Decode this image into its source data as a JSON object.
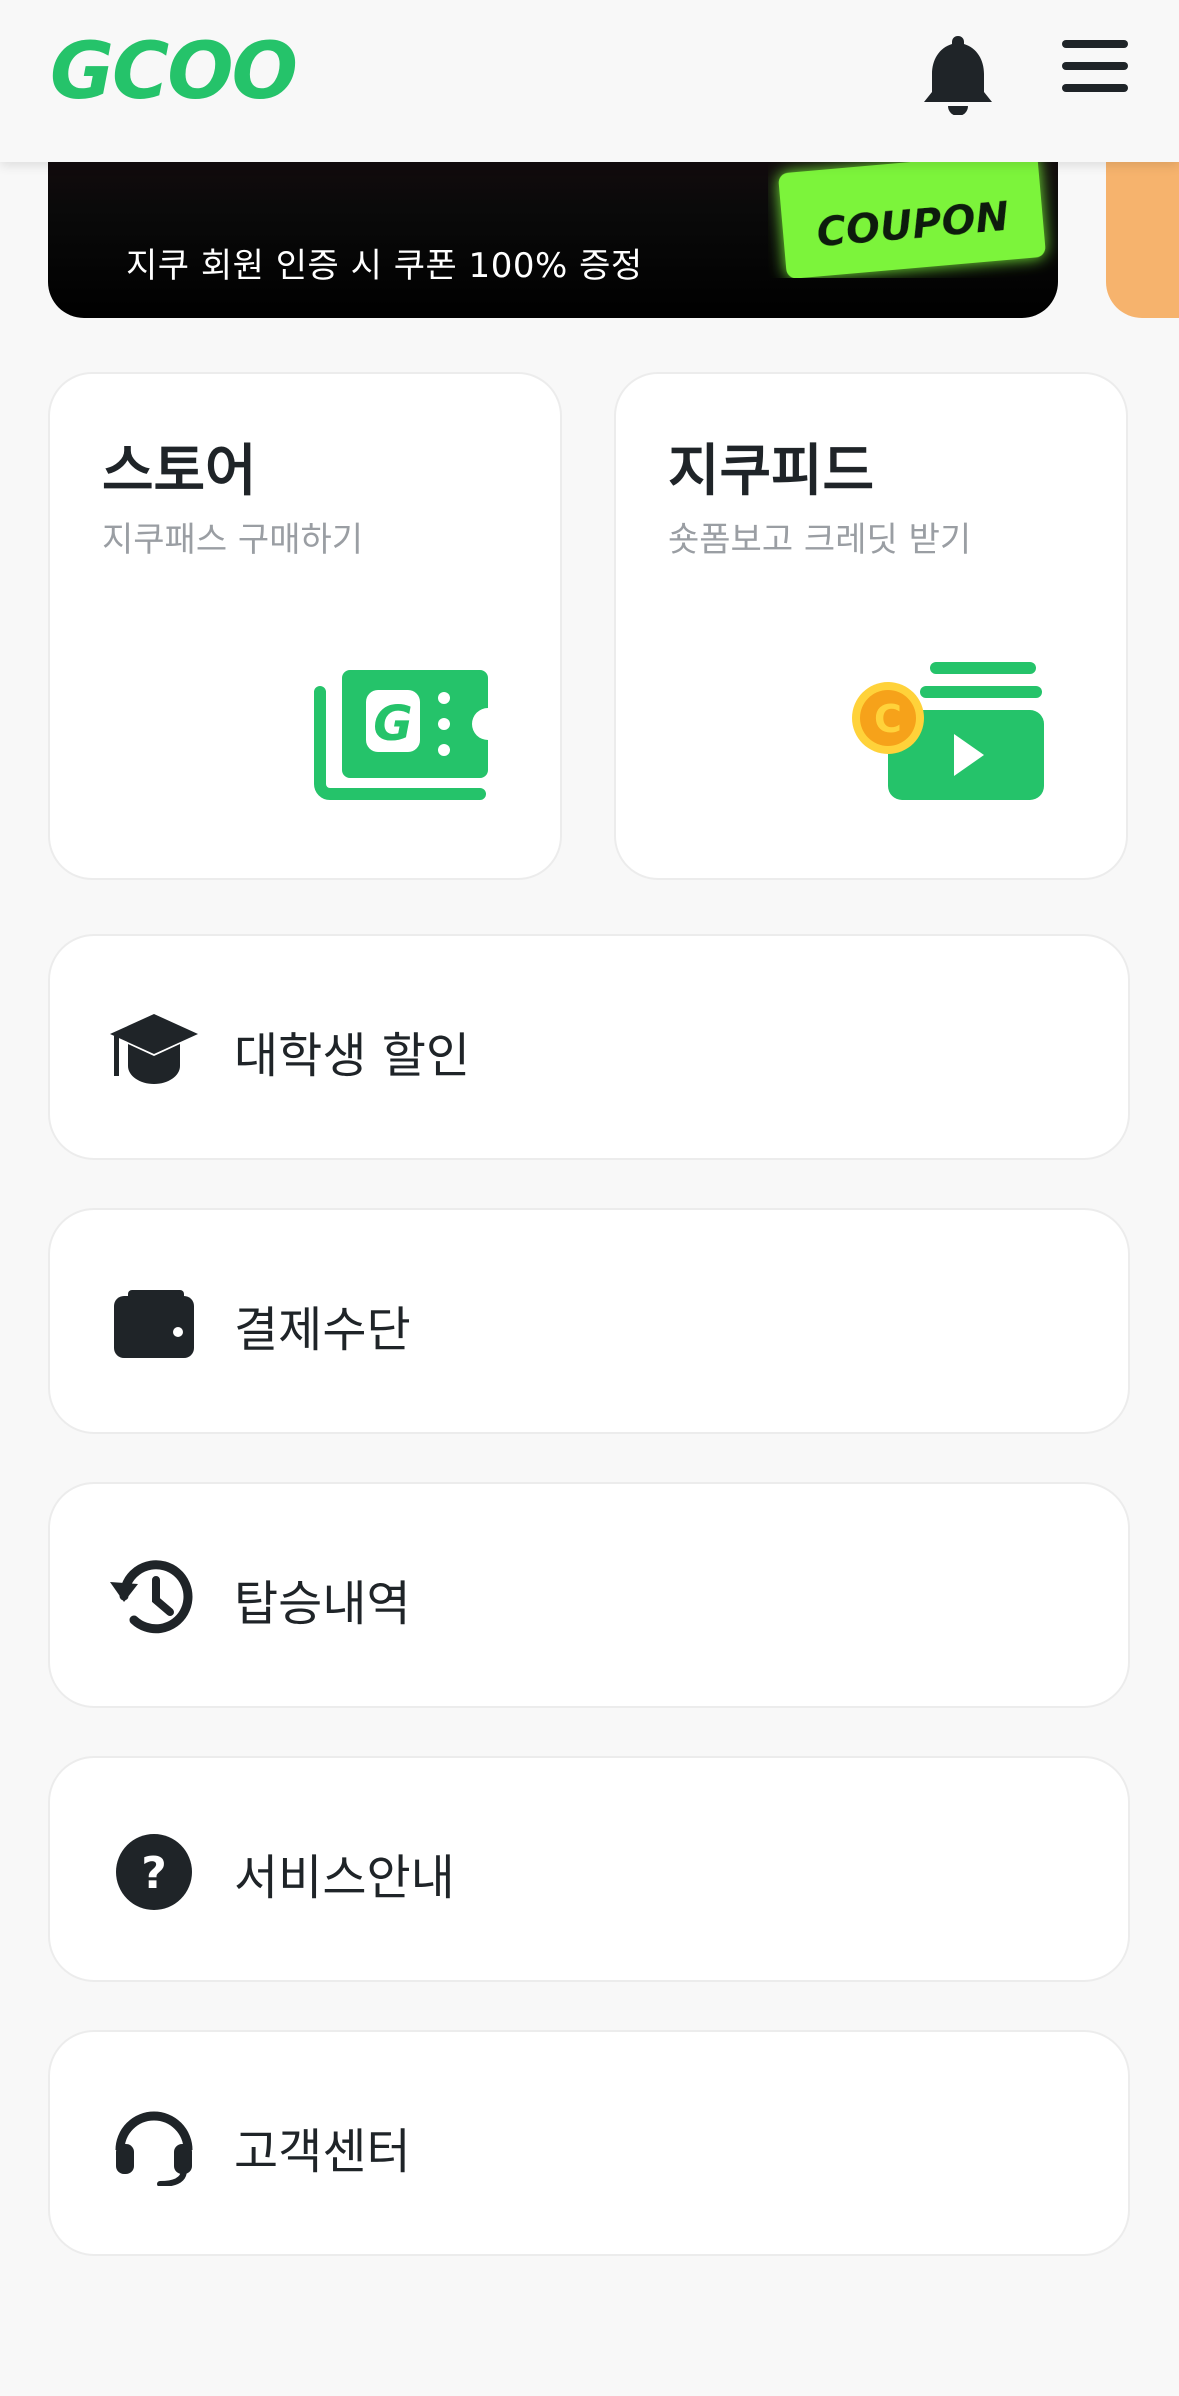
{
  "header": {
    "logo": "GCOO",
    "brand_color": "#25c36a"
  },
  "banner": {
    "subtitle": "지쿠 회원 인증 시 쿠폰 100% 증정",
    "coupon_text": "COUPON",
    "coupon_color": "#7cf43a"
  },
  "tiles": [
    {
      "title": "스토어",
      "subtitle": "지쿠패스 구매하기",
      "icon": "ticket-icon"
    },
    {
      "title": "지쿠피드",
      "subtitle": "숏폼보고 크레딧 받기",
      "icon": "video-coin-icon"
    }
  ],
  "menu": [
    {
      "label": "대학생 할인",
      "icon": "graduation-cap-icon"
    },
    {
      "label": "결제수단",
      "icon": "wallet-icon"
    },
    {
      "label": "탑승내역",
      "icon": "history-icon"
    },
    {
      "label": "서비스안내",
      "icon": "question-icon"
    },
    {
      "label": "고객센터",
      "icon": "headset-icon"
    }
  ]
}
